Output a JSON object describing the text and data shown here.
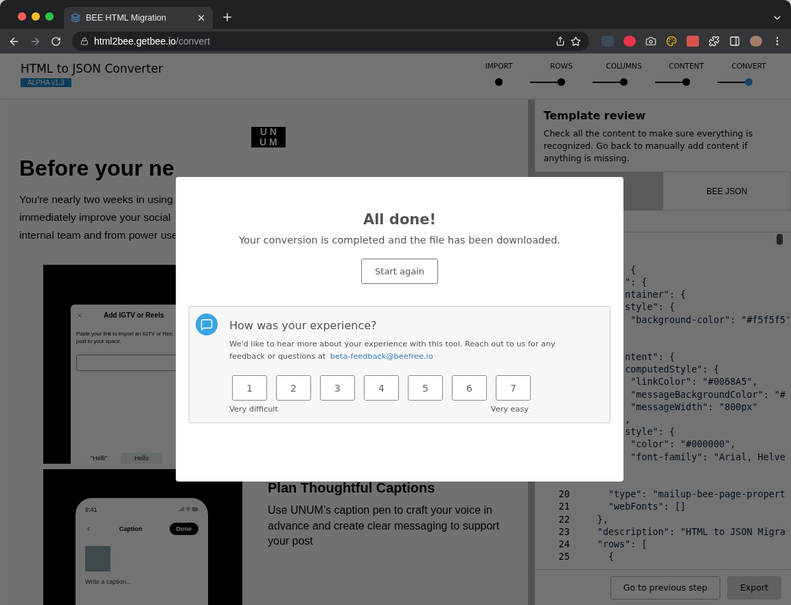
{
  "browser": {
    "tab_title": "BEE HTML Migration",
    "url_host": "html2bee.getbee.io",
    "url_path": "/convert"
  },
  "header": {
    "title": "HTML to JSON Converter",
    "badge": "ALPHA v1.3",
    "steps": [
      {
        "label": "IMPORT",
        "selected": false
      },
      {
        "label": "ROWS",
        "selected": false
      },
      {
        "label": "COLUMNS",
        "selected": false
      },
      {
        "label": "CONTENT",
        "selected": false
      },
      {
        "label": "CONVERT",
        "selected": true
      }
    ]
  },
  "preview": {
    "logo": [
      "UN",
      "UM"
    ],
    "heading": "Before your ne",
    "paragraph_lines": [
      "You're nearly two weeks in using",
      "immediately improve your social",
      "internal team and from power use"
    ],
    "embed_dialog": {
      "title": "Add IGTV or Reels",
      "text_lines": [
        "Paste your link to import an IGTV or Ree",
        "post to your space."
      ],
      "tabs": [
        "\"Helli\"",
        "Hello"
      ]
    },
    "embed_phone": {
      "time": "9:41",
      "title": "Caption",
      "action": "Done",
      "placeholder": "Write a caption..."
    },
    "feature": {
      "heading": "Plan Thoughtful Captions",
      "text": "Use UNUM’s caption pen to craft your voice in advance and create clear messaging to support your post"
    }
  },
  "review": {
    "title": "Template review",
    "description": "Check all the content to make sure everything is recognized. Go back to manually add content if anything is missing.",
    "tabs": [
      {
        "selected": false
      },
      {
        "label": "BEE JSON",
        "selected": true
      }
    ],
    "code_lines": [
      {
        "kind": "blank"
      },
      {
        "kind": "code",
        "code": "        {"
      },
      {
        "kind": "code",
        "code": "       \": {"
      },
      {
        "kind": "code",
        "code": "       ntainer\": {"
      },
      {
        "kind": "code",
        "code": "       style\": {"
      },
      {
        "kind": "code",
        "code": "        \"background-color\": \"#f5f5f5'"
      },
      {
        "kind": "blank"
      },
      {
        "kind": "blank"
      },
      {
        "kind": "code",
        "code": "       ntent\": {"
      },
      {
        "kind": "code",
        "code": "       computedStyle\": {"
      },
      {
        "kind": "code",
        "code": "        \"linkColor\": \"#0068A5\","
      },
      {
        "kind": "code",
        "code": "        \"messageBackgroundColor\": \"#"
      },
      {
        "kind": "code",
        "code": "        \"messageWidth\": \"800px\""
      },
      {
        "kind": "code",
        "code": "       ,"
      },
      {
        "kind": "code",
        "code": "       style\": {"
      },
      {
        "kind": "code",
        "code": "        \"color\": \"#000000\","
      },
      {
        "kind": "code",
        "code": "        \"font-family\": \"Arial, Helve"
      },
      {
        "kind": "blank"
      },
      {
        "kind": "blank"
      },
      {
        "kind": "code",
        "number": "20",
        "code": "    \"type\": \"mailup-bee-page-propert"
      },
      {
        "kind": "code",
        "number": "21",
        "code": "    \"webFonts\": []"
      },
      {
        "kind": "code",
        "number": "22",
        "code": "  },"
      },
      {
        "kind": "code",
        "number": "23",
        "code": "  \"description\": \"HTML to JSON Migra"
      },
      {
        "kind": "code",
        "number": "24",
        "code": "  \"rows\": ["
      },
      {
        "kind": "code",
        "number": "25",
        "code": "    {"
      }
    ],
    "buttons": [
      {
        "label": "Go to previous step",
        "kind": "secondary"
      },
      {
        "label": "Export",
        "kind": "primary"
      }
    ]
  },
  "modal": {
    "title": "All done!",
    "message": "Your conversion is completed and the file has been downloaded.",
    "button": "Start again",
    "feedback": {
      "title": "How was your experience?",
      "text": "We'd like to hear more about your experience with this tool. Reach out to us for any feedback or questions at ",
      "email": "beta-feedback@beefree.io",
      "scale": [
        "1",
        "2",
        "3",
        "4",
        "5",
        "6",
        "7"
      ],
      "low_label": "Very difficult",
      "high_label": "Very easy"
    }
  }
}
